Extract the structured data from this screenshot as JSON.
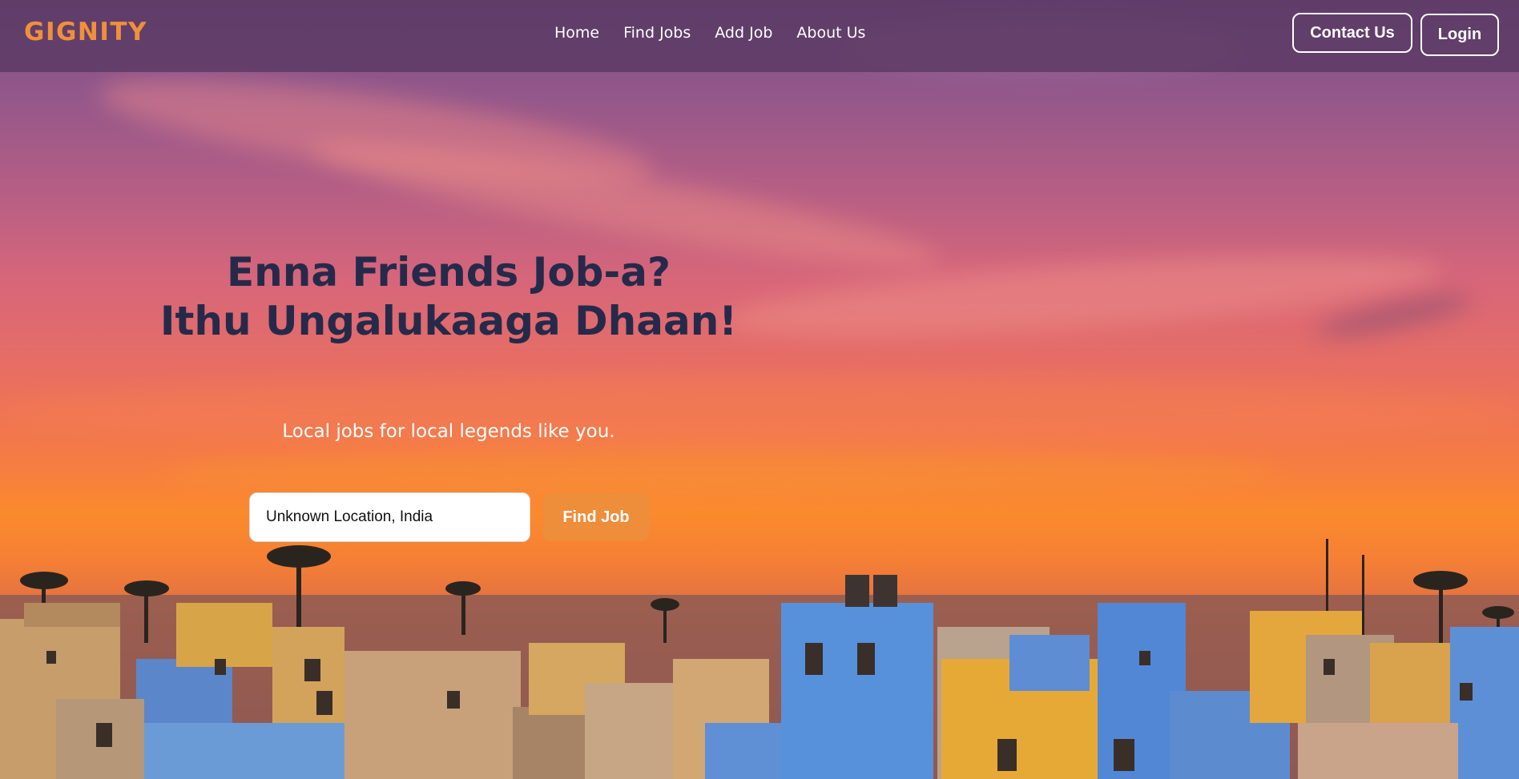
{
  "brand": {
    "name": "GIGNITY",
    "color": "#f0903a"
  },
  "nav": {
    "links": [
      "Home",
      "Find Jobs",
      "Add Job",
      "About Us"
    ],
    "contact_label": "Contact Us",
    "login_label": "Login"
  },
  "hero": {
    "title_line1": "Enna Friends Job-a?",
    "title_line2": "Ithu Ungalukaaga Dhaan!",
    "subtitle": "Local jobs for local legends like you."
  },
  "search": {
    "value": "Unknown Location, India",
    "button_label": "Find Job",
    "button_color": "#ee8d3a"
  }
}
